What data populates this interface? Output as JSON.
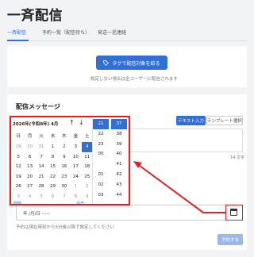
{
  "page_title": "一斉配信",
  "tabs": [
    {
      "label": "一斉配信"
    },
    {
      "label": "予約一覧（配信待ち）"
    },
    {
      "label": "発送一括連絡"
    }
  ],
  "filter": {
    "button_label": "タグで配信対象を絞る",
    "note": "設定しない場合は全ユーザーに配信されます"
  },
  "message": {
    "section_title": "配信メッセージ",
    "text_button": "テキスト入力",
    "template_button": "テンプレート選択",
    "char_count": "14 文字"
  },
  "schedule": {
    "date_placeholder": "年 /月/日 --:--",
    "note": "予約は現在時刻から5分後以降で設定してください",
    "submit_label": "予約する"
  },
  "picker": {
    "header": "2026年(令和8年) 4月",
    "prev_icon": "arrow-up-icon",
    "next_icon": "arrow-down-icon",
    "weekdays": [
      "日",
      "月",
      "火",
      "水",
      "木",
      "金",
      "土"
    ],
    "days": [
      {
        "d": "29",
        "out": true
      },
      {
        "d": "30",
        "out": true
      },
      {
        "d": "31",
        "out": true
      },
      {
        "d": "1"
      },
      {
        "d": "2"
      },
      {
        "d": "3"
      },
      {
        "d": "4",
        "sel": true
      },
      {
        "d": "5"
      },
      {
        "d": "6"
      },
      {
        "d": "7"
      },
      {
        "d": "8"
      },
      {
        "d": "9"
      },
      {
        "d": "10"
      },
      {
        "d": "11"
      },
      {
        "d": "12"
      },
      {
        "d": "13"
      },
      {
        "d": "14"
      },
      {
        "d": "15"
      },
      {
        "d": "16"
      },
      {
        "d": "17"
      },
      {
        "d": "18"
      },
      {
        "d": "19"
      },
      {
        "d": "20"
      },
      {
        "d": "21"
      },
      {
        "d": "22"
      },
      {
        "d": "23"
      },
      {
        "d": "24"
      },
      {
        "d": "25"
      },
      {
        "d": "26"
      },
      {
        "d": "27"
      },
      {
        "d": "28"
      },
      {
        "d": "29"
      },
      {
        "d": "30"
      },
      {
        "d": "1",
        "out": true
      },
      {
        "d": "2",
        "out": true
      },
      {
        "d": "3",
        "out": true
      },
      {
        "d": "4",
        "out": true
      },
      {
        "d": "5",
        "out": true
      },
      {
        "d": "6",
        "out": true
      },
      {
        "d": "7",
        "out": true
      },
      {
        "d": "8",
        "out": true
      },
      {
        "d": "9",
        "out": true
      }
    ],
    "clear_label": "削除",
    "today_label": "今日",
    "hours": [
      "21",
      "22",
      "23",
      "00",
      "",
      "01",
      "02",
      "03"
    ],
    "hour_selected": "21",
    "minutes": [
      "37",
      "38",
      "39",
      "40",
      "41",
      "42",
      "43",
      "44"
    ],
    "minute_selected": "37"
  }
}
